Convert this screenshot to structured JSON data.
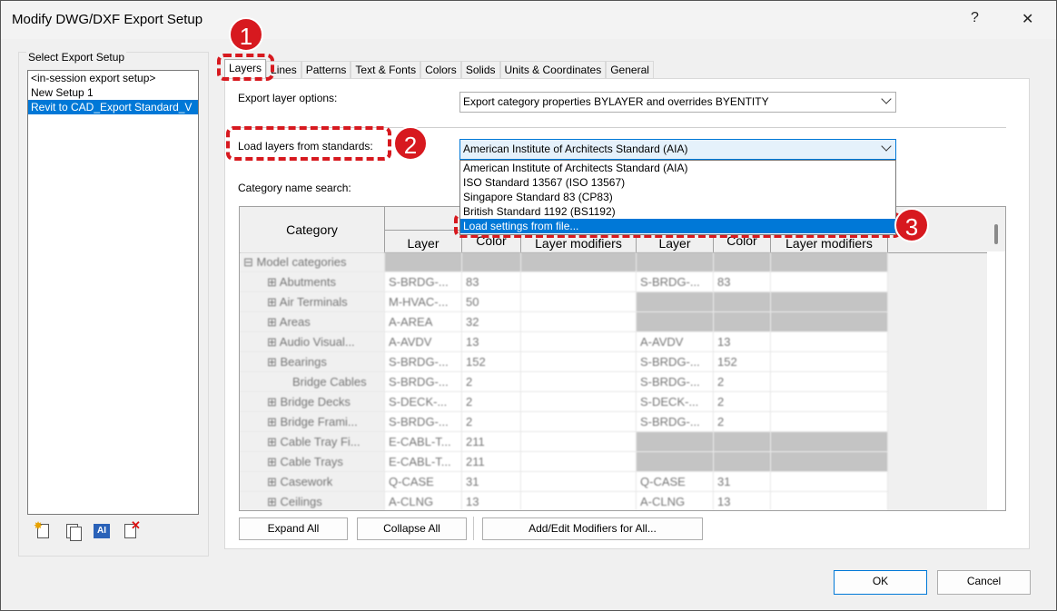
{
  "window": {
    "title": "Modify DWG/DXF Export Setup",
    "help_label": "?",
    "close_label": "✕"
  },
  "left": {
    "group_label": "Select Export Setup",
    "setups": [
      "<in-session export setup>",
      "New Setup 1",
      "Revit to CAD_Export Standard_V"
    ],
    "selected_index": 2
  },
  "tabs": [
    "Layers",
    "Lines",
    "Patterns",
    "Text & Fonts",
    "Colors",
    "Solids",
    "Units & Coordinates",
    "General"
  ],
  "active_tab": "Layers",
  "layers": {
    "export_options_label": "Export layer options:",
    "export_options_value": "Export category properties BYLAYER and overrides BYENTITY",
    "load_label": "Load layers from standards:",
    "load_value": "American Institute of Architects Standard (AIA)",
    "dropdown_options": [
      "American Institute of Architects Standard (AIA)",
      "ISO Standard 13567 (ISO 13567)",
      "Singapore Standard 83 (CP83)",
      "British Standard 1192 (BS1192)",
      "Load settings from file..."
    ],
    "dropdown_highlight_index": 4,
    "search_label": "Category name search:"
  },
  "grid": {
    "col_category": "Category",
    "col_layer": "Layer",
    "col_color": "Color",
    "col_modifiers": "Layer modifiers",
    "rows": [
      {
        "name": "Model categories",
        "indent": 0,
        "expander": "minus",
        "layer": "",
        "color": "",
        "mod": "",
        "p_layer": "",
        "p_color": "",
        "p_mod": "",
        "group": true
      },
      {
        "name": "Abutments",
        "indent": 1,
        "expander": "plus",
        "layer": "S-BRDG-...",
        "color": "83",
        "mod": "",
        "p_layer": "S-BRDG-...",
        "p_color": "83",
        "p_mod": ""
      },
      {
        "name": "Air Terminals",
        "indent": 1,
        "expander": "plus",
        "layer": "M-HVAC-...",
        "color": "50",
        "mod": "",
        "p_layer": "",
        "p_color": "",
        "p_mod": "",
        "p_gray": true
      },
      {
        "name": "Areas",
        "indent": 1,
        "expander": "plus",
        "layer": "A-AREA",
        "color": "32",
        "mod": "",
        "p_layer": "",
        "p_color": "",
        "p_mod": "",
        "p_gray": true
      },
      {
        "name": "Audio Visual...",
        "indent": 1,
        "expander": "plus",
        "layer": "A-AVDV",
        "color": "13",
        "mod": "",
        "p_layer": "A-AVDV",
        "p_color": "13",
        "p_mod": ""
      },
      {
        "name": "Bearings",
        "indent": 1,
        "expander": "plus",
        "layer": "S-BRDG-...",
        "color": "152",
        "mod": "",
        "p_layer": "S-BRDG-...",
        "p_color": "152",
        "p_mod": ""
      },
      {
        "name": "Bridge Cables",
        "indent": 1,
        "expander": "none",
        "layer": "S-BRDG-...",
        "color": "2",
        "mod": "",
        "p_layer": "S-BRDG-...",
        "p_color": "2",
        "p_mod": ""
      },
      {
        "name": "Bridge Decks",
        "indent": 1,
        "expander": "plus",
        "layer": "S-DECK-...",
        "color": "2",
        "mod": "",
        "p_layer": "S-DECK-...",
        "p_color": "2",
        "p_mod": ""
      },
      {
        "name": "Bridge Frami...",
        "indent": 1,
        "expander": "plus",
        "layer": "S-BRDG-...",
        "color": "2",
        "mod": "",
        "p_layer": "S-BRDG-...",
        "p_color": "2",
        "p_mod": ""
      },
      {
        "name": "Cable Tray Fi...",
        "indent": 1,
        "expander": "plus",
        "layer": "E-CABL-T...",
        "color": "211",
        "mod": "",
        "p_layer": "",
        "p_color": "",
        "p_mod": "",
        "p_gray": true
      },
      {
        "name": "Cable Trays",
        "indent": 1,
        "expander": "plus",
        "layer": "E-CABL-T...",
        "color": "211",
        "mod": "",
        "p_layer": "",
        "p_color": "",
        "p_mod": "",
        "p_gray": true
      },
      {
        "name": "Casework",
        "indent": 1,
        "expander": "plus",
        "layer": "Q-CASE",
        "color": "31",
        "mod": "",
        "p_layer": "Q-CASE",
        "p_color": "31",
        "p_mod": ""
      },
      {
        "name": "Ceilings",
        "indent": 1,
        "expander": "plus",
        "layer": "A-CLNG",
        "color": "13",
        "mod": "",
        "p_layer": "A-CLNG",
        "p_color": "13",
        "p_mod": ""
      }
    ]
  },
  "buttons": {
    "expand_all": "Expand All",
    "collapse_all": "Collapse All",
    "add_edit": "Add/Edit Modifiers for All...",
    "ok": "OK",
    "cancel": "Cancel"
  },
  "callouts": [
    "1",
    "2",
    "3"
  ],
  "colors": {
    "accent": "#0078d7",
    "callout_red": "#d7191f"
  }
}
